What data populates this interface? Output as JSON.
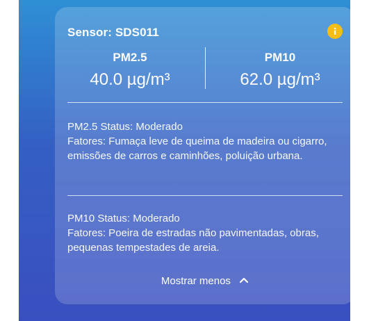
{
  "sensor": {
    "title": "Sensor: SDS011",
    "info_icon": "info-icon",
    "accent_color": "#f6bd16"
  },
  "metrics": {
    "pm25": {
      "label": "PM2.5",
      "value": "40.0 µg/m³"
    },
    "pm10": {
      "label": "PM10",
      "value": "62.0 µg/m³"
    }
  },
  "details": {
    "pm25": {
      "status": "PM2.5 Status: Moderado",
      "factors": "Fatores: Fumaça leve de queima de madeira ou cigarro, emissões de carros e caminhões, poluição urbana."
    },
    "pm10": {
      "status": "PM10 Status: Moderado",
      "factors": "Fatores: Poeira de estradas não pavimentadas, obras, pequenas tempestades de areia."
    }
  },
  "toggle": {
    "label": "Mostrar menos",
    "icon": "chevron-up-icon"
  }
}
